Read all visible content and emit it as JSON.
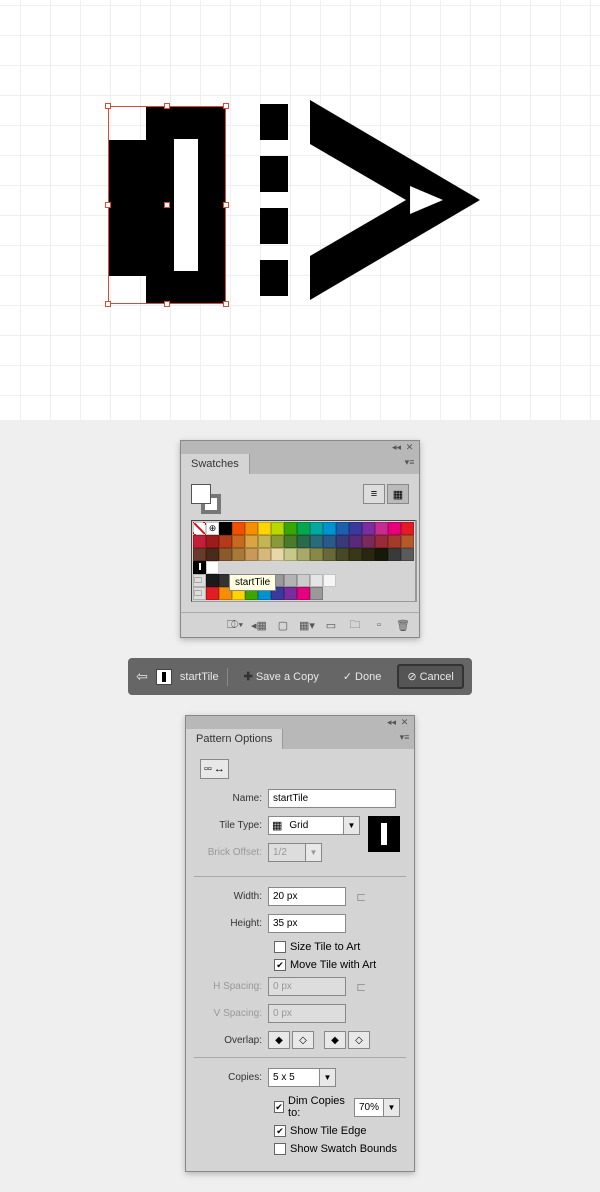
{
  "swatches_panel": {
    "title": "Swatches",
    "tooltip": "startTile",
    "view_list_icon": "list-view-icon",
    "view_grid_icon": "grid-view-icon",
    "rows": [
      [
        "#ffffff",
        "#ffffff",
        "#000000",
        "#f24f00",
        "#f58e00",
        "#ffd400",
        "#b8d900",
        "#3aa600",
        "#00a84f",
        "#00a99d",
        "#0093d1",
        "#1b5fae",
        "#3a3a9e",
        "#7a2d9e",
        "#c62c8f",
        "#e6007e",
        "#e31b23"
      ],
      [
        "#c41e3a",
        "#9e1b1b",
        "#b33a1a",
        "#c76a1f",
        "#d9a441",
        "#c4b454",
        "#8a9a3b",
        "#4a7a2a",
        "#2a6a4a",
        "#2a6a7a",
        "#2a5a8a",
        "#3a3a7a",
        "#5a2a7a",
        "#7a2a5a",
        "#9a2a3a",
        "#a43a2a",
        "#b35a2a"
      ],
      [
        "#6a3a2a",
        "#4a2a1a",
        "#8a5a2a",
        "#a87a3a",
        "#c89a5a",
        "#d8b87a",
        "#e8d8a8",
        "#c8c888",
        "#a8a868",
        "#888848",
        "#686838",
        "#484828",
        "#383818",
        "#282810",
        "#181808",
        "#3a3a3a",
        "#5a5a5a"
      ],
      [
        "#111111",
        "#ffffff",
        "",
        "",
        "",
        "",
        "",
        "",
        "",
        "",
        "",
        "",
        "",
        "",
        "",
        "",
        ""
      ]
    ],
    "gray_row": [
      "#1a1a1a",
      "#333333",
      "#4d4d4d",
      "#666666",
      "#808080",
      "#999999",
      "#b3b3b3",
      "#cccccc",
      "#e5e5e5",
      "#f5f5f5"
    ],
    "recent_row": [
      "#e31b23",
      "#f58e00",
      "#ffd400",
      "#3aa600",
      "#0093d1",
      "#3a3a9e",
      "#7a2d9e",
      "#e6007e",
      "#999999"
    ]
  },
  "pattern_toolbar": {
    "back_icon": "back-arrow-icon",
    "pattern_name": "startTile",
    "save_copy": "Save a Copy",
    "done": "Done",
    "cancel": "Cancel"
  },
  "pattern_options": {
    "title": "Pattern Options",
    "name_label": "Name:",
    "name_value": "startTile",
    "tile_type_label": "Tile Type:",
    "tile_type_value": "Grid",
    "brick_offset_label": "Brick Offset:",
    "brick_offset_value": "1/2",
    "width_label": "Width:",
    "width_value": "20 px",
    "height_label": "Height:",
    "height_value": "35 px",
    "size_tile_label": "Size Tile to Art",
    "move_tile_label": "Move Tile with Art",
    "h_spacing_label": "H Spacing:",
    "h_spacing_value": "0 px",
    "v_spacing_label": "V Spacing:",
    "v_spacing_value": "0 px",
    "overlap_label": "Overlap:",
    "copies_label": "Copies:",
    "copies_value": "5 x 5",
    "dim_copies_label": "Dim Copies to:",
    "dim_copies_value": "70%",
    "show_tile_edge_label": "Show Tile Edge",
    "show_swatch_bounds_label": "Show Swatch Bounds"
  }
}
